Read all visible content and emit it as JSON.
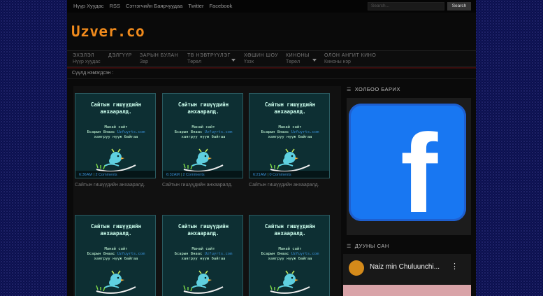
{
  "topbar": {
    "links": [
      "Нүүр Хуудас",
      "RSS",
      "Сэтгэгчийн Баярчуудаа",
      "Twitter",
      "Facebook"
    ],
    "search_placeholder": "Search...",
    "search_button": "Search"
  },
  "logo": "Uzver.co",
  "nav": [
    {
      "top": "ЭХЭЛЭЛ",
      "sub": "Нүүр хуудас",
      "dropdown": false
    },
    {
      "top": "ДЭЛГҮҮР",
      "sub": "",
      "dropdown": false
    },
    {
      "top": "ЗАРЫН БУЛАН",
      "sub": "Зар",
      "dropdown": false
    },
    {
      "top": "ТВ НЭВТРҮҮЛЭГ",
      "sub": "Төрөл",
      "dropdown": true
    },
    {
      "top": "ХӨШИН ШОУ",
      "sub": "Үзэх",
      "dropdown": false
    },
    {
      "top": "КИНОНЫ",
      "sub": "Төрөл",
      "dropdown": true
    },
    {
      "top": "ОЛОН АНГИТ КИНО",
      "sub": "Киноны нэр",
      "dropdown": false
    }
  ],
  "recent_label": "Сүүлд нэмэгдсэн :",
  "thumb": {
    "title_line1": "Сайтын гишүүдийн",
    "title_line2": "анхааралд.",
    "body_line1": "Манай сайт",
    "body_line2_pre": "Бсарын 8наас",
    "body_link": "Uzfuyrts.com",
    "body_line3": "хаягруу нүүж байгаа"
  },
  "posts": [
    {
      "time": "6:36AM",
      "comments": "2 Comments",
      "caption": "Сайтын гишүүдийн анхааралд."
    },
    {
      "time": "6:32AM",
      "comments": "2 Comments",
      "caption": "Сайтын гишүүдийн анхааралд."
    },
    {
      "time": "6:21AM",
      "comments": "0 Comments",
      "caption": "Сайтын гишүүдийн анхааралд."
    },
    {
      "time": "",
      "comments": "",
      "caption": ""
    },
    {
      "time": "",
      "comments": "",
      "caption": ""
    },
    {
      "time": "",
      "comments": "",
      "caption": ""
    }
  ],
  "sidebar": {
    "contact_heading": "ХОЛБОО БАРИХ",
    "music_heading": "ДУУНЫ САН",
    "video_title": "Naiz min Chuluunchi..."
  },
  "colors": {
    "logo": "#f08a1c",
    "facebook": "#1877f2",
    "thumb_bg": "#0d2f33",
    "page_bg": "#0b0f4a"
  }
}
